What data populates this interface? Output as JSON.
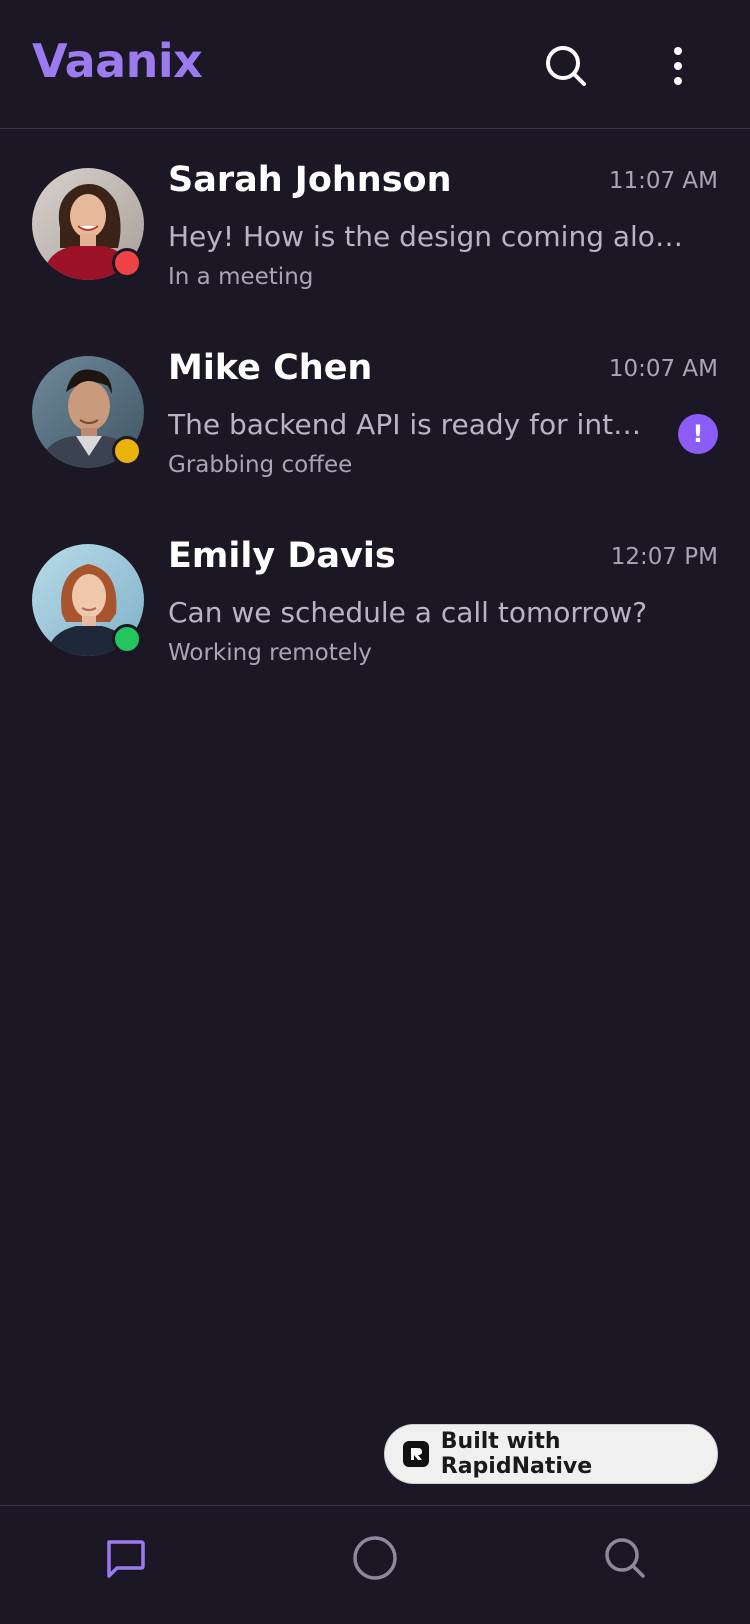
{
  "header": {
    "title": "Vaanix",
    "search_icon": "search-icon",
    "more_icon": "more-vertical-icon"
  },
  "chats": [
    {
      "name": "Sarah Johnson",
      "time": "11:07 AM",
      "message": "Hey! How is the design coming along?",
      "status_text": "In a meeting",
      "status_color": "#ef4444",
      "unread_badge": ""
    },
    {
      "name": "Mike Chen",
      "time": "10:07 AM",
      "message": "The backend API is ready for integration",
      "status_text": "Grabbing coffee",
      "status_color": "#eab308",
      "unread_badge": "!"
    },
    {
      "name": "Emily Davis",
      "time": "12:07 PM",
      "message": "Can we schedule a call tomorrow?",
      "status_text": "Working remotely",
      "status_color": "#22c55e",
      "unread_badge": ""
    }
  ],
  "badge": {
    "label": "Built with RapidNative"
  },
  "tabs": [
    {
      "label": "",
      "icon": "chat-bubble-icon",
      "active": true
    },
    {
      "label": "",
      "icon": "circle-icon",
      "active": false
    },
    {
      "label": "",
      "icon": "search-icon",
      "active": false
    }
  ],
  "colors": {
    "accent": "#9b7bef",
    "background": "#1b1724",
    "badge_purple": "#8b5cf6"
  }
}
